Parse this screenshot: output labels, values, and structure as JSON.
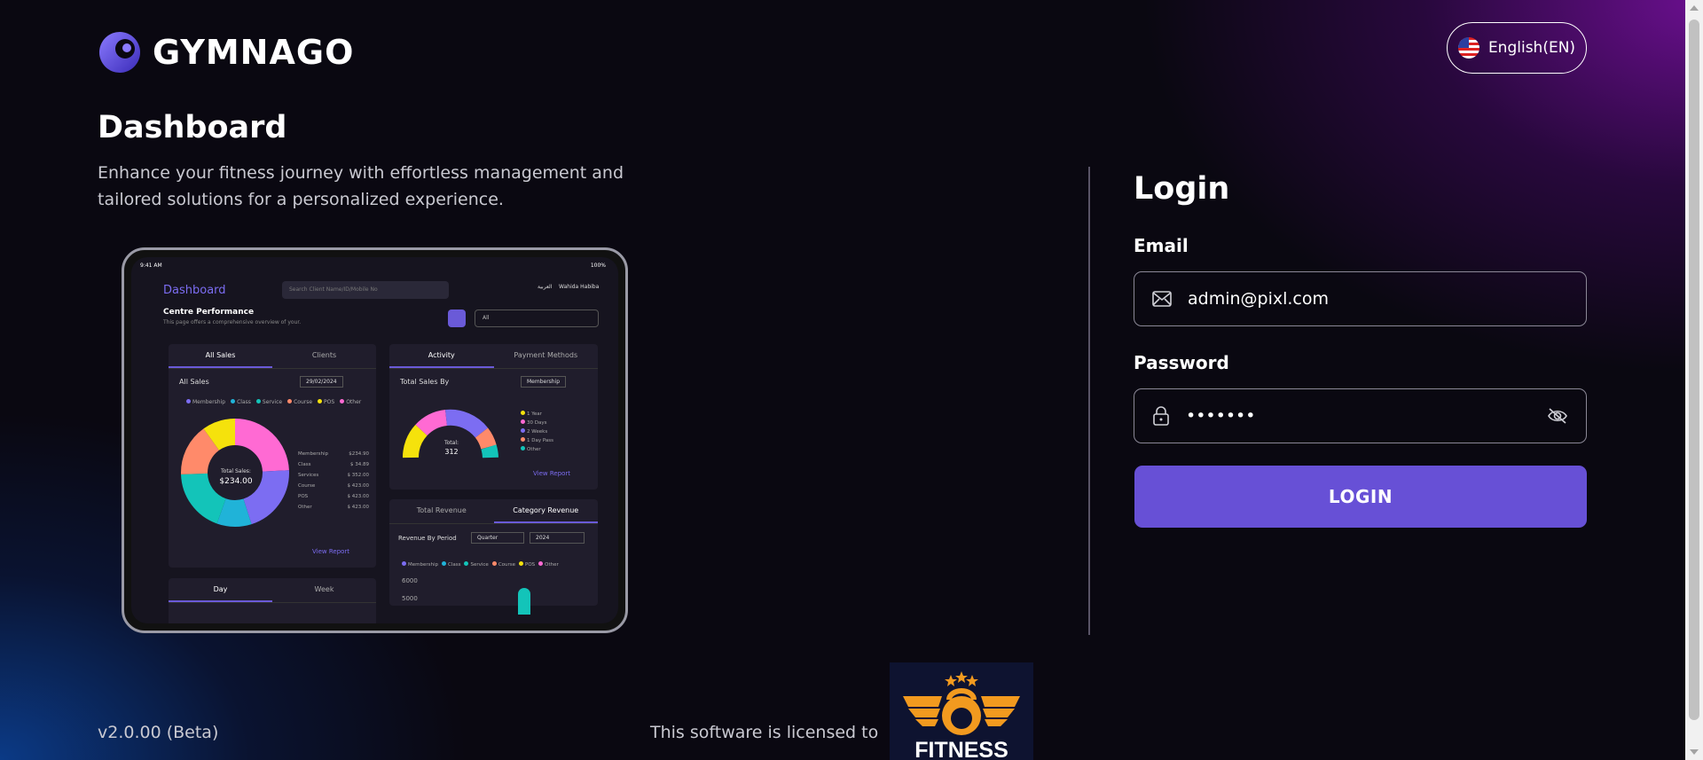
{
  "brand": {
    "name": "GYMNAGO"
  },
  "language": {
    "label": "English(EN)",
    "flag": "us-flag-icon"
  },
  "hero": {
    "title": "Dashboard",
    "subtitle": "Enhance your fitness journey with effortless management and tailored solutions for a personalized experience."
  },
  "preview": {
    "status_time": "9:41 AM",
    "status_battery": "100%",
    "title": "Dashboard",
    "search_placeholder": "Search Client Name/ID/Mobile No",
    "language": "العربية",
    "user": "Wahida Habiba",
    "section_title": "Centre Performance",
    "section_sub": "This page offers a comprehensive overview of your.",
    "filter": "All",
    "sales_card": {
      "tabs": [
        "All Sales",
        "Clients"
      ],
      "title": "All Sales",
      "date": "29/02/2024",
      "legend": [
        "Membership",
        "Class",
        "Service",
        "Course",
        "POS",
        "Other"
      ],
      "center_label": "Total Sales:",
      "center_value": "$234.00",
      "rows": [
        {
          "label": "Membership",
          "value": "$234.90"
        },
        {
          "label": "Class",
          "value": "$ 34.89"
        },
        {
          "label": "Services",
          "value": "$ 352.00"
        },
        {
          "label": "Course",
          "value": "$ 423.00"
        },
        {
          "label": "POS",
          "value": "$ 423.00"
        },
        {
          "label": "Other",
          "value": "$ 423.00"
        }
      ],
      "link": "View Report"
    },
    "activity_card": {
      "tabs": [
        "Activity",
        "Payment Methods"
      ],
      "title": "Total Sales By",
      "select": "Membership",
      "center_label": "Total:",
      "center_value": "312",
      "legend": [
        "1 Year",
        "30 Days",
        "2 Weeks",
        "1 Day Pass",
        "Other"
      ],
      "link": "View Report"
    },
    "revenue_card": {
      "tabs": [
        "Total Revenue",
        "Category Revenue"
      ],
      "title": "Revenue By Period",
      "period": "Quarter",
      "year": "2024",
      "legend": [
        "Membership",
        "Class",
        "Service",
        "Course",
        "POS",
        "Other"
      ],
      "y_ticks": [
        "6000",
        "5000"
      ]
    },
    "day_card": {
      "tabs": [
        "Day",
        "Week"
      ]
    }
  },
  "login": {
    "title": "Login",
    "email_label": "Email",
    "email_value": "admin@pixl.com",
    "password_label": "Password",
    "password_value": "•••••••",
    "button": "LOGIN"
  },
  "footer": {
    "version": "v2.0.00 (Beta)",
    "licensed": "This software is licensed to",
    "licensee_logo_text": "FITNESS"
  },
  "colors": {
    "accent": "#6750d6",
    "background": "#0a0811",
    "purple_glow": "#6a0f8e",
    "blue_glow": "#0b3a86"
  }
}
